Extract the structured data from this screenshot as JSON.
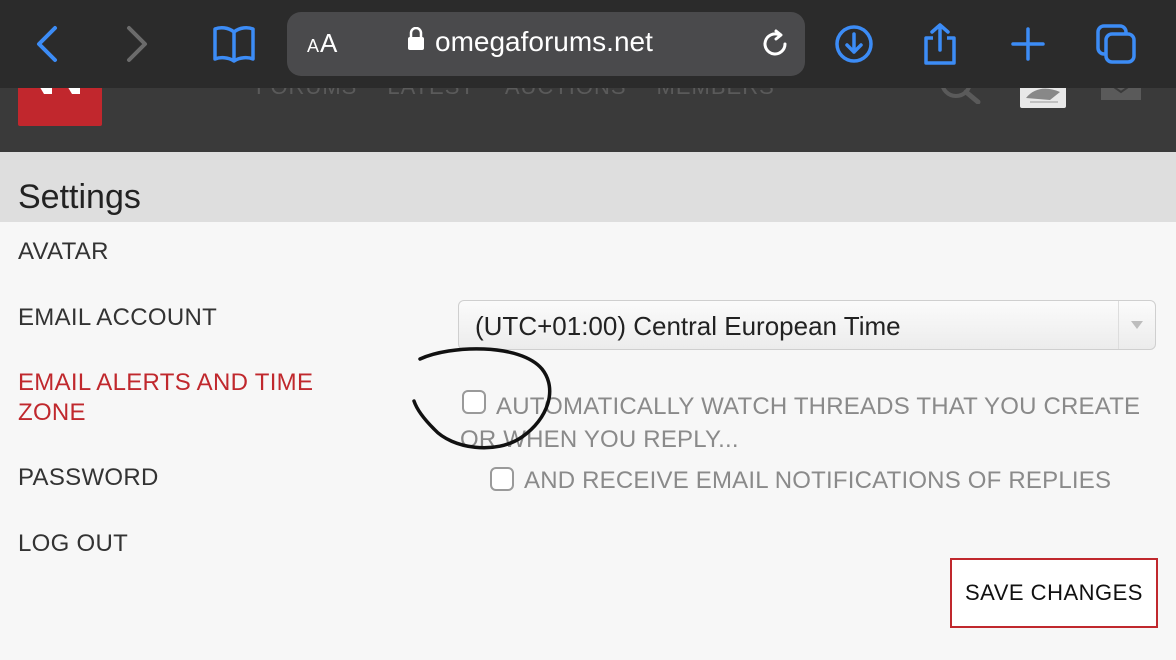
{
  "browser": {
    "text_size_label_small": "A",
    "text_size_label_large": "A",
    "url": "omegaforums.net",
    "icons": [
      "back-icon",
      "forward-icon",
      "bookmarks-icon",
      "lock-icon",
      "reload-icon",
      "download-icon",
      "share-icon",
      "new-tab-icon",
      "tabs-icon"
    ]
  },
  "header": {
    "nav": [
      "FORUMS",
      "LATEST",
      "AUCTIONS",
      "MEMBERS"
    ]
  },
  "settings": {
    "title": "Settings",
    "menu": [
      {
        "label": "AVATAR"
      },
      {
        "label": "EMAIL ACCOUNT"
      },
      {
        "label": "EMAIL ALERTS AND TIME ZONE"
      },
      {
        "label": "PASSWORD"
      },
      {
        "label": "LOG OUT"
      }
    ],
    "timezone": "(UTC+01:00) Central European Time",
    "options": {
      "watch_threads": "AUTOMATICALLY WATCH THREADS THAT YOU CREATE OR WHEN YOU REPLY...",
      "email_notifications": "AND RECEIVE EMAIL NOTIFICATIONS OF REPLIES"
    },
    "save_label": "SAVE CHANGES"
  },
  "colors": {
    "accent": "#c0282d",
    "ios_blue": "#3c8cf6",
    "browser_bar": "#2b2b2b"
  }
}
